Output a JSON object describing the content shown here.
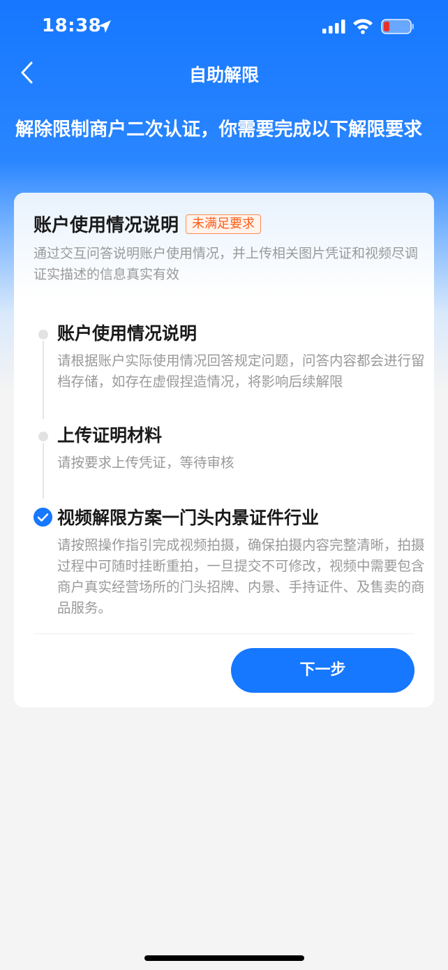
{
  "status_bar": {
    "time": "18:38",
    "icons": [
      "location-arrow-icon",
      "cellular-signal-icon",
      "wifi-icon",
      "battery-low-icon"
    ],
    "battery_color": "#e5322d"
  },
  "nav": {
    "back_icon": "chevron-left-icon",
    "title": "自助解限"
  },
  "headline": "解除限制商户二次认证，你需要完成以下解限要求",
  "card": {
    "title": "账户使用情况说明",
    "status_badge": "未满足要求",
    "description": "通过交互问答说明账户使用情况，并上传相关图片凭证和视频尽调证实描述的信息真实有效",
    "steps": [
      {
        "title": "账户使用情况说明",
        "description": "请根据账户实际使用情况回答规定问题，问答内容都会进行留档存储，如存在虚假捏造情况，将影响后续解限",
        "state": "pending"
      },
      {
        "title": "上传证明材料",
        "description": "请按要求上传凭证，等待审核",
        "state": "pending"
      },
      {
        "title": "视频解限方案一门头内景证件行业",
        "description": "请按照操作指引完成视频拍摄，确保拍摄内容完整清晰，拍摄过程中可随时挂断重拍，一旦提交不可修改，视频中需要包含商户真实经营场所的门头招牌、内景、手持证件、及售卖的商品服务。",
        "state": "checked"
      }
    ],
    "next_button": "下一步"
  },
  "colors": {
    "brand_blue": "#1677ff",
    "badge_orange": "#ff5d18",
    "muted_text": "#999999"
  }
}
